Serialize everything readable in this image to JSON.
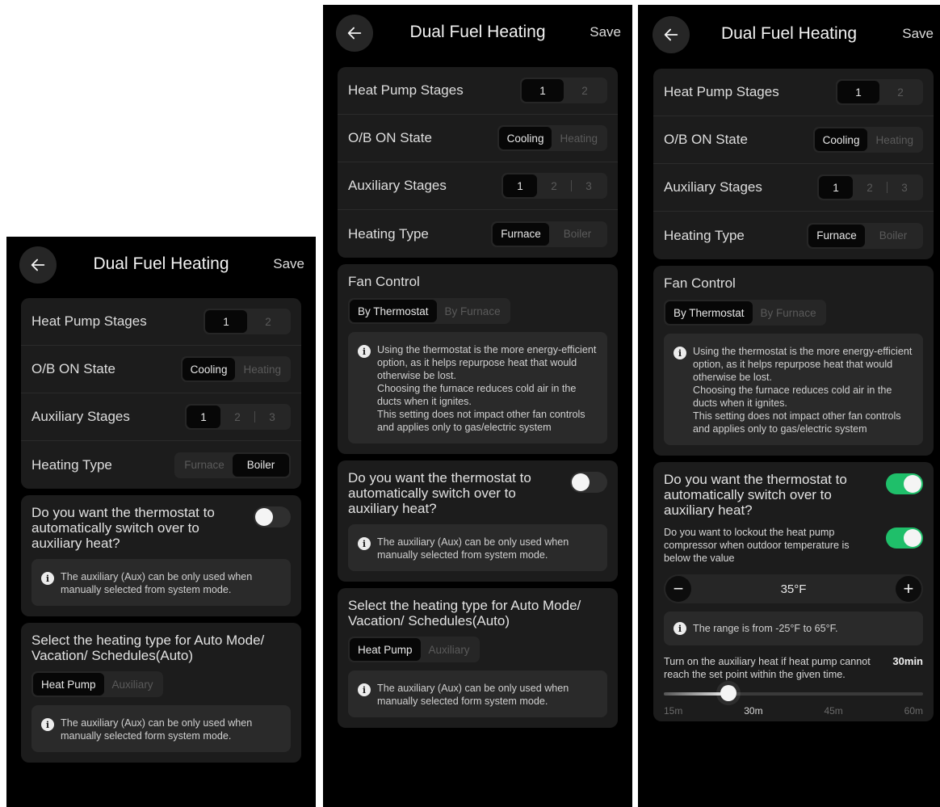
{
  "header": {
    "title": "Dual Fuel Heating",
    "save_label": "Save"
  },
  "settings": {
    "heat_pump_stages": {
      "label": "Heat Pump Stages",
      "options": [
        "1",
        "2"
      ]
    },
    "ob_state": {
      "label": "O/B ON State",
      "options": [
        "Cooling",
        "Heating"
      ]
    },
    "aux_stages": {
      "label": "Auxiliary Stages",
      "options": [
        "1",
        "2",
        "3"
      ]
    },
    "heating_type": {
      "label": "Heating Type",
      "options": [
        "Furnace",
        "Boiler"
      ]
    }
  },
  "fan_control": {
    "title": "Fan Control",
    "options": [
      "By Thermostat",
      "By Furnace"
    ],
    "info": [
      "Using the thermostat is the more energy-efficient option, as it helps repurpose heat that would otherwise be lost.",
      "Choosing the furnace reduces cold air in the ducts when it ignites.",
      "This setting does not impact other fan controls and applies only to gas/electric system"
    ]
  },
  "auto_switch": {
    "question": "Do you want the thermostat to automatically switch over to auxiliary heat?",
    "info": "The auxiliary (Aux) can be only used when manually selected from system mode."
  },
  "heat_source": {
    "title": "Select the heating type for Auto Mode/ Vacation/ Schedules(Auto)",
    "options": [
      "Heat Pump",
      "Auxiliary"
    ],
    "info": "The auxiliary (Aux) can be only used when manually selected form system mode."
  },
  "lockout": {
    "question": "Do you want to lockout the heat pump compressor when outdoor temperature is below the value",
    "value": "35°F",
    "minus": "−",
    "plus": "+",
    "range_note": "The range is from -25°F to 65°F."
  },
  "aux_timer": {
    "text": "Turn on the auxiliary heat if heat pump cannot reach the set point within the given time.",
    "value": "30min",
    "ticks": [
      "15m",
      "30m",
      "45m",
      "60m"
    ],
    "position": 0.25
  },
  "icons": {
    "back": "arrow-left-icon",
    "info": "info-icon"
  },
  "colors": {
    "toggle_on": "#1fbf6a",
    "background": "#000000",
    "card": "#1c1c1c"
  }
}
